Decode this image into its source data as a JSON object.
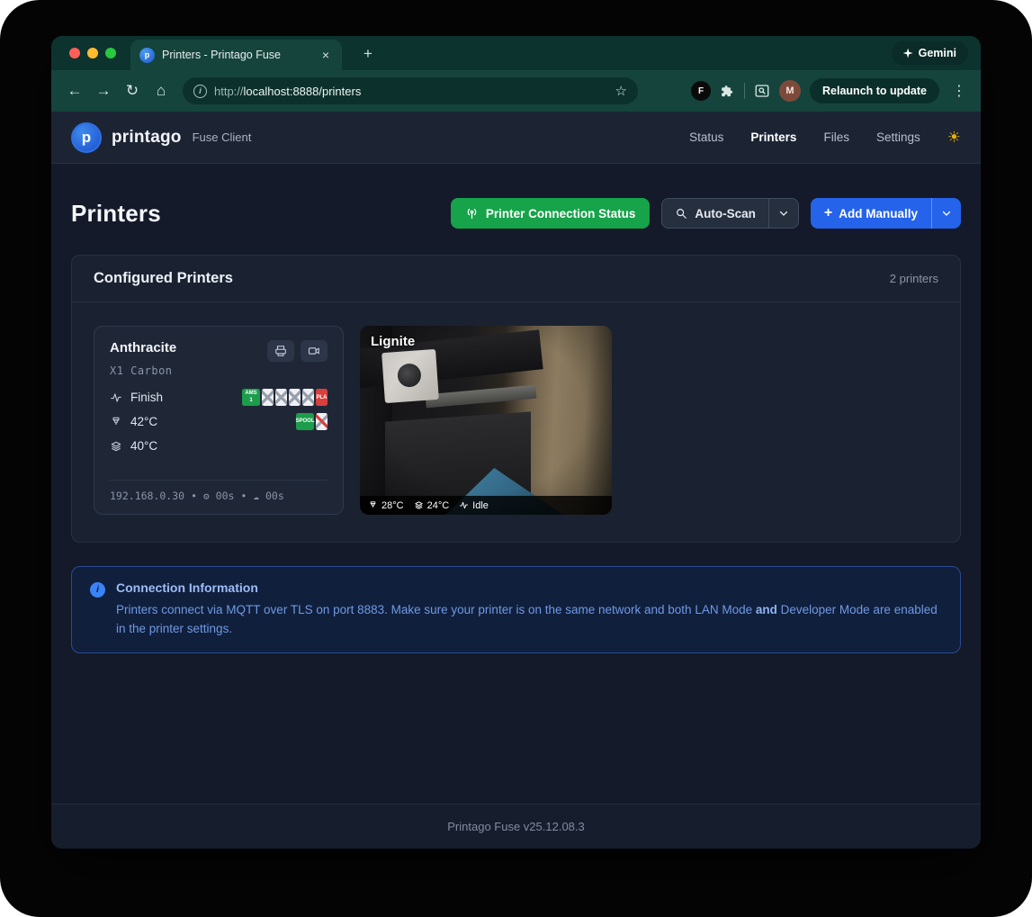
{
  "theme": {
    "chrome_teal": "#15443d",
    "page_bg": "#141a29",
    "accent_green": "#16a34a",
    "accent_blue": "#2563eb",
    "info_blue": "#6f99e4",
    "sun_yellow": "#eab308"
  },
  "browser": {
    "tab_title": "Printers - Printago Fuse",
    "gemini_label": "Gemini",
    "url": {
      "scheme": "http://",
      "host": "localhost",
      "path": ":8888/printers"
    },
    "relaunch_label": "Relaunch to update",
    "profile_initial": "M",
    "extension_badge": "F"
  },
  "icons": {
    "back": "←",
    "forward": "→",
    "reload": "↻",
    "home": "⌂",
    "star": "☆",
    "menu": "⋮",
    "close_tab": "×",
    "plus": "+",
    "info": "i",
    "sun": "☀",
    "gear": "⚙",
    "cloud": "☁",
    "dot": "•",
    "favicon_letter": "p",
    "logo_letter": "p"
  },
  "header": {
    "brand": "printago",
    "subtitle": "Fuse Client",
    "nav": [
      {
        "label": "Status"
      },
      {
        "label": "Printers"
      },
      {
        "label": "Files"
      },
      {
        "label": "Settings"
      }
    ]
  },
  "page": {
    "title": "Printers",
    "connection_status_label": "Printer Connection Status",
    "auto_scan_label": "Auto-Scan",
    "add_manually_label": "Add Manually"
  },
  "configured": {
    "title": "Configured Printers",
    "count": "2 printers"
  },
  "printers": [
    {
      "name": "Anthracite",
      "model": "X1 Carbon",
      "status": "Finish",
      "nozzle_temp": "42°C",
      "bed_temp": "40°C",
      "ip": "192.168.0.30",
      "uptime": "00s",
      "cloud_time": "00s",
      "ams_badge": "AMS 1",
      "ams_material": "PLA",
      "spool_badge": "SPOOL"
    },
    {
      "name": "Lignite",
      "nozzle_temp": "28°C",
      "bed_temp": "24°C",
      "status": "Idle"
    }
  ],
  "info": {
    "title": "Connection Information",
    "text_1": "Printers connect via MQTT over TLS on port 8883. Make sure your printer is on the same network and both LAN Mode ",
    "text_bold": "and",
    "text_2": " Developer Mode are enabled in the printer settings."
  },
  "footer": {
    "version": "Printago Fuse v25.12.08.3"
  }
}
